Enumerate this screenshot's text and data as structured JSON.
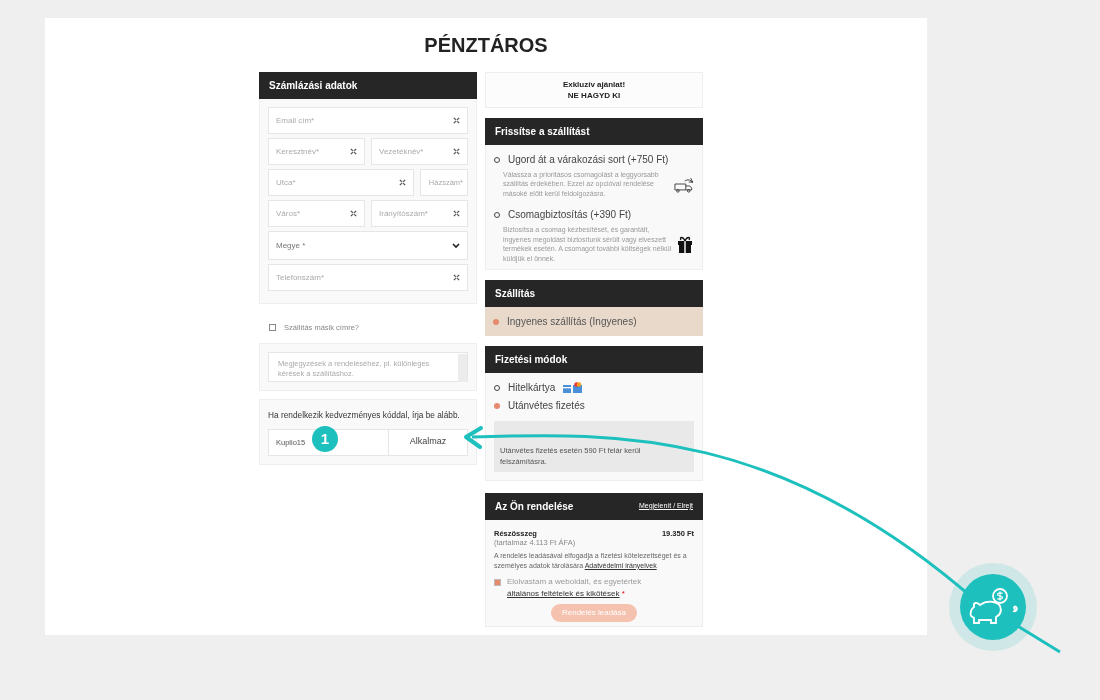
{
  "page_title": "PÉNZTÁROS",
  "billing": {
    "title": "Számlázási adatok",
    "rows": [
      [
        {
          "kind": "text",
          "placeholder": "Email cím*",
          "clear": true
        }
      ],
      [
        {
          "kind": "text",
          "placeholder": "Keresztnév*",
          "clear": true
        },
        {
          "kind": "text",
          "placeholder": "Vezetéknév*",
          "clear": true
        }
      ],
      [
        {
          "kind": "text",
          "placeholder": "Utca*",
          "clear": true
        },
        {
          "kind": "text",
          "placeholder": "Házszám*",
          "clear": false
        }
      ],
      [
        {
          "kind": "text",
          "placeholder": "Város*",
          "clear": true
        },
        {
          "kind": "text",
          "placeholder": "Irányítószám*",
          "clear": true
        }
      ],
      [
        {
          "kind": "select",
          "placeholder": "Megye *"
        }
      ],
      [
        {
          "kind": "text",
          "placeholder": "Telefonszám*",
          "clear": true
        }
      ]
    ]
  },
  "ship_elsewhere": {
    "label": "Szállítás másik címre?",
    "checked": false
  },
  "notes": {
    "placeholder": "Megjegyzések a rendeléséhez, pl. különleges kérések a szállításhoz."
  },
  "coupon": {
    "prompt": "Ha rendelkezik kedvezményes kóddal, írja be alább.",
    "value": "Kuplio15",
    "button": "Alkalmaz"
  },
  "offer": {
    "line1": "Exkluzív ajánlat!",
    "line2": "NE HAGYD KI"
  },
  "upgrades": {
    "title": "Frissítse a szállítást",
    "options": [
      {
        "label": "Ugord át a várakozási sort (+750 Ft)",
        "description": "Válassza a prioritásos csomagolást a leggyorsabb szállítás érdekében. Ezzel az opcióval rendelése másoké előtt kerül feldolgozásra.",
        "selected": false
      },
      {
        "label": "Csomagbiztosítás (+390 Ft)",
        "description": "Biztosítsa a csomag kézbesítését, és garantált, ingyenes megoldást biztosítunk sérült vagy elveszett termékek esetén. A csomagot további költségek nélkül küldjük el önnek.",
        "selected": false
      }
    ]
  },
  "shipping": {
    "title": "Szállítás",
    "options": [
      {
        "label": "Ingyenes szállítás (Ingyenes)",
        "selected": true
      }
    ]
  },
  "payment": {
    "title": "Fizetési módok",
    "methods": [
      {
        "label": "Hitelkártya",
        "selected": false,
        "cards": true
      },
      {
        "label": "Utánvétes fizetés",
        "selected": true,
        "cards": false
      }
    ],
    "note": "Utánvétes fizetés esetén 590 Ft felár kerül felszámításra."
  },
  "order": {
    "title": "Az Ön rendelése",
    "toggle": "Megjelenít / Elrejt",
    "subtotal_label": "Részösszeg",
    "tax_note": "(tartalmaz 4.113 Ft ÁFA)",
    "subtotal": "19.350 Ft",
    "privacy_text": "A rendelés leadásával elfogadja a fizetési kötelezettséget és a személyes adatok tárolására",
    "privacy_link": "Adatvédelmi irányelvek",
    "terms_text": "Elolvastam a weboldalt, és egyetértek",
    "terms_link": "általános feltételek és kikötések",
    "terms_required": "*",
    "terms_checked": true,
    "submit": "Rendelés leadása"
  },
  "callout": {
    "number": "1"
  }
}
